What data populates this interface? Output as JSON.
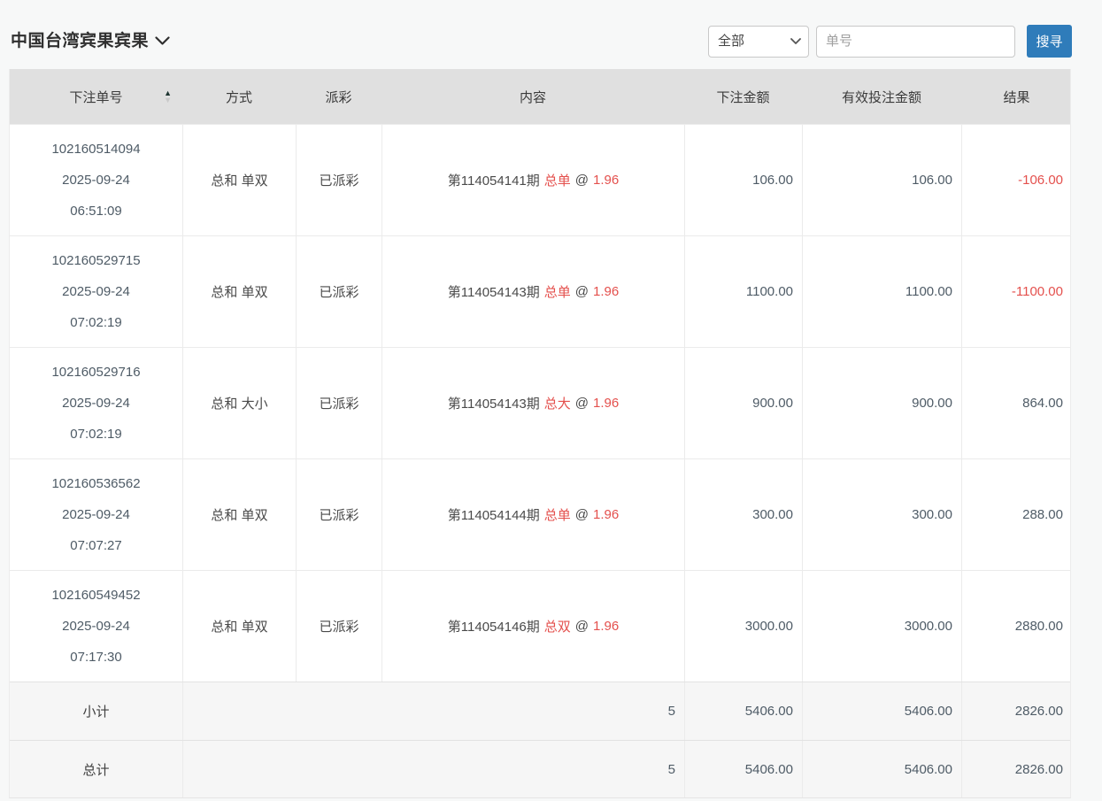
{
  "page": {
    "title": "中国台湾宾果宾果",
    "filter": {
      "selected": "全部",
      "order_placeholder": "单号",
      "search_label": "搜寻"
    }
  },
  "table": {
    "headers": [
      "下注单号",
      "方式",
      "派彩",
      "内容",
      "下注金额",
      "有效投注金额",
      "结果"
    ],
    "rows": [
      {
        "order_id": "102160514094",
        "date": "2025-09-24",
        "time": "06:51:09",
        "method": "总和 单双",
        "payout": "已派彩",
        "period": "第114054141期",
        "pick": "总单",
        "at": "@",
        "odds": "1.96",
        "bet": "106.00",
        "valid": "106.00",
        "result": "-106.00"
      },
      {
        "order_id": "102160529715",
        "date": "2025-09-24",
        "time": "07:02:19",
        "method": "总和 单双",
        "payout": "已派彩",
        "period": "第114054143期",
        "pick": "总单",
        "at": "@",
        "odds": "1.96",
        "bet": "1100.00",
        "valid": "1100.00",
        "result": "-1100.00"
      },
      {
        "order_id": "102160529716",
        "date": "2025-09-24",
        "time": "07:02:19",
        "method": "总和 大小",
        "payout": "已派彩",
        "period": "第114054143期",
        "pick": "总大",
        "at": "@",
        "odds": "1.96",
        "bet": "900.00",
        "valid": "900.00",
        "result": "864.00"
      },
      {
        "order_id": "102160536562",
        "date": "2025-09-24",
        "time": "07:07:27",
        "method": "总和 单双",
        "payout": "已派彩",
        "period": "第114054144期",
        "pick": "总单",
        "at": "@",
        "odds": "1.96",
        "bet": "300.00",
        "valid": "300.00",
        "result": "288.00"
      },
      {
        "order_id": "102160549452",
        "date": "2025-09-24",
        "time": "07:17:30",
        "method": "总和 单双",
        "payout": "已派彩",
        "period": "第114054146期",
        "pick": "总双",
        "at": "@",
        "odds": "1.96",
        "bet": "3000.00",
        "valid": "3000.00",
        "result": "2880.00"
      }
    ],
    "subtotal": {
      "label": "小计",
      "count": "5",
      "bet": "5406.00",
      "valid": "5406.00",
      "result": "2826.00"
    },
    "total": {
      "label": "总计",
      "count": "5",
      "bet": "5406.00",
      "valid": "5406.00",
      "result": "2826.00"
    },
    "sort": {
      "asc_icon": "▲",
      "desc_icon": "▼"
    }
  },
  "colors": {
    "accent_blue": "#2f7cba",
    "negative_red": "#e4504d",
    "header_gray": "#e0e0e0"
  }
}
